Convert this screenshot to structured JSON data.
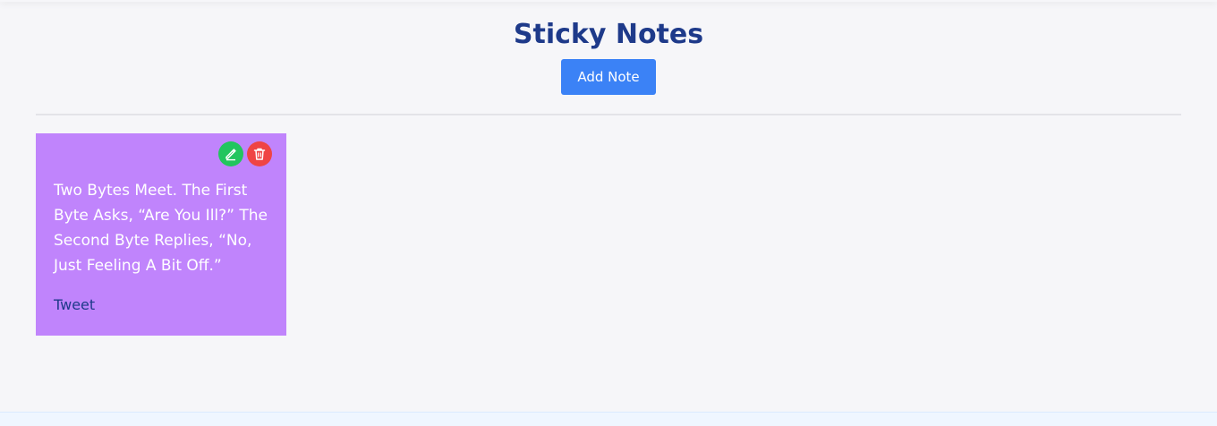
{
  "header": {
    "title": "Sticky Notes",
    "add_button_label": "Add Note"
  },
  "notes": [
    {
      "text": "Two Bytes Meet. The First Byte Asks, “Are You Ill?” The Second Byte Replies, “No, Just Feeling A Bit Off.”",
      "tag": "Tweet",
      "color": "#c084fc"
    }
  ],
  "icons": {
    "edit": "pencil-icon",
    "delete": "trash-icon"
  },
  "colors": {
    "accent": "#3b82f6",
    "title": "#1e3a8a",
    "edit": "#22c55e",
    "delete": "#ef4444"
  }
}
